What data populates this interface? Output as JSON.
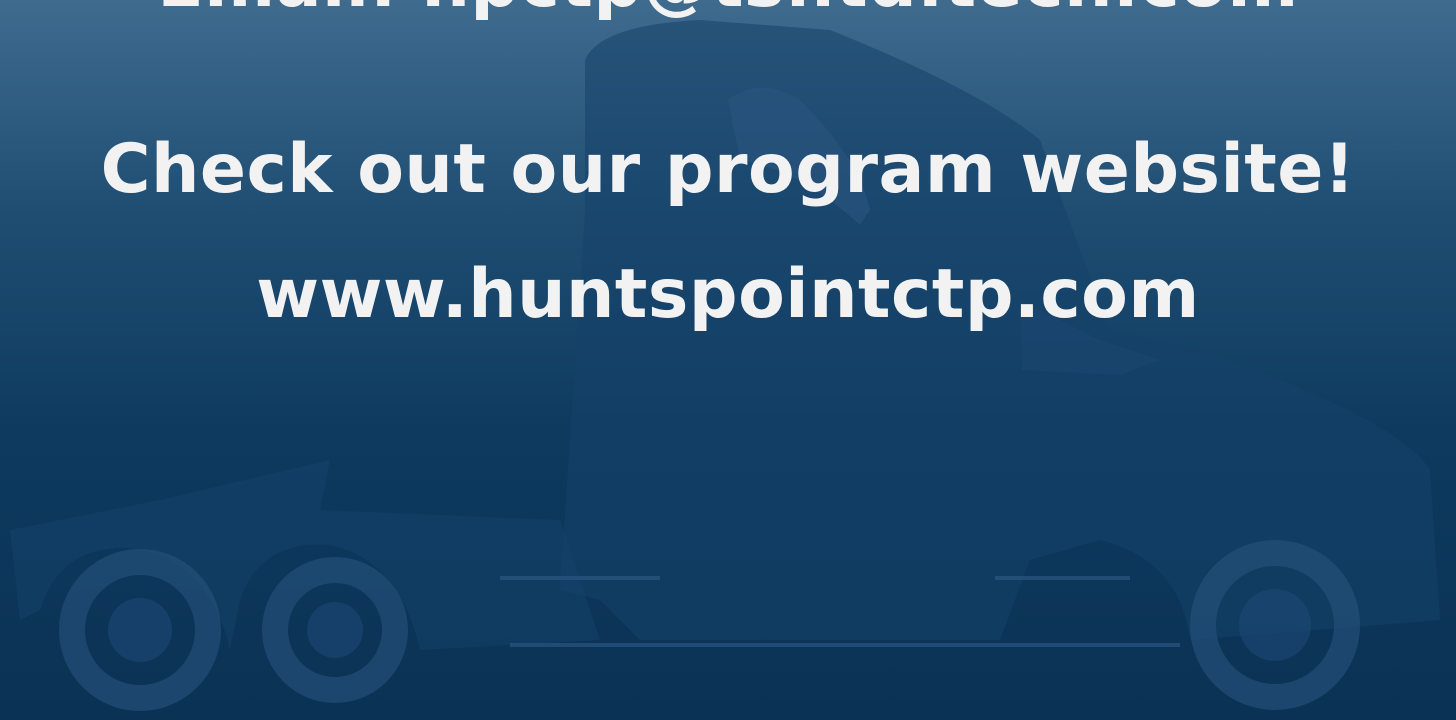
{
  "slide": {
    "email_line": "Email: hpctp@ts.itd.tech.com",
    "cta_heading": "Check out our program website!",
    "website_url": "www.huntspointctp.com"
  },
  "background": {
    "graphic": "semi-truck-silhouette-icon",
    "colors": {
      "top": "#3f6b8f",
      "bottom": "#0a3254",
      "silhouette": "#163e61"
    }
  }
}
